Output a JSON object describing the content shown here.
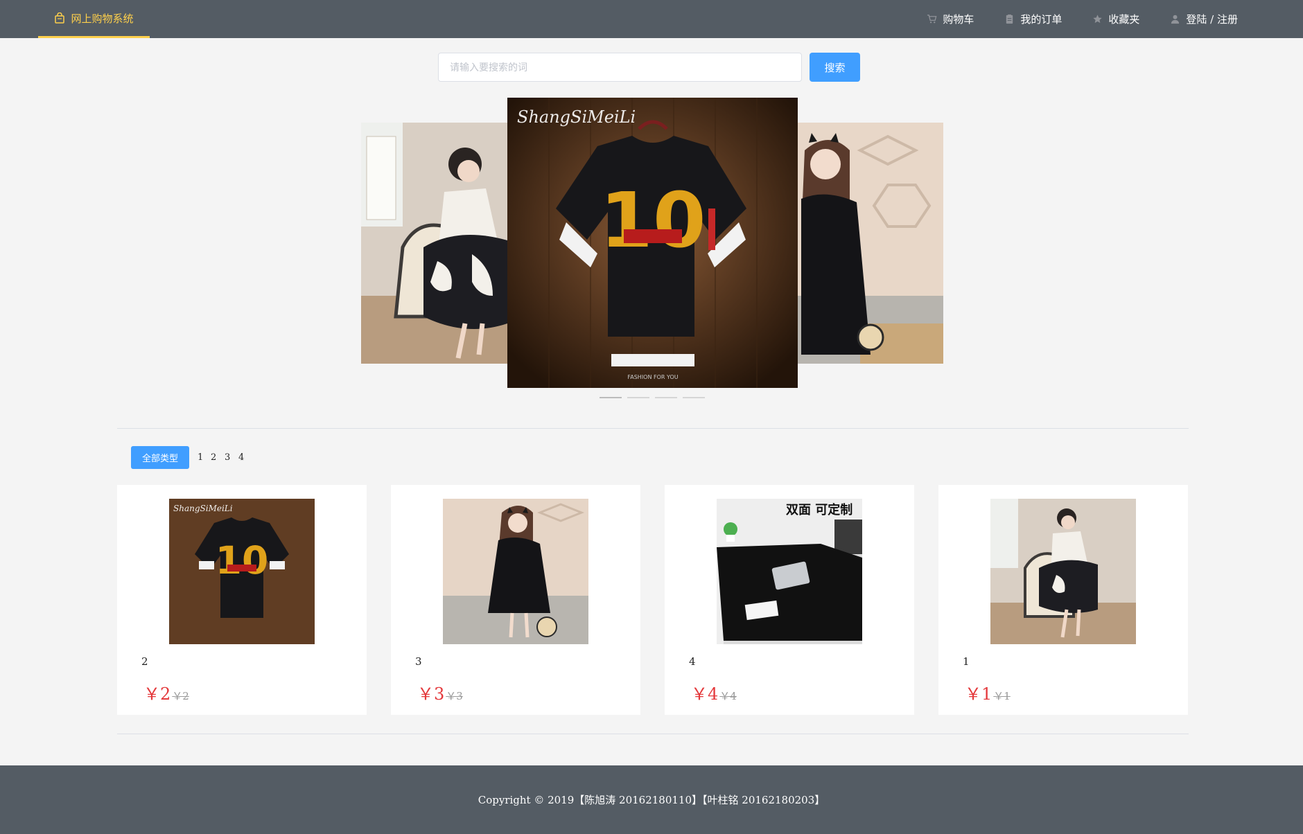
{
  "header": {
    "brand": "网上购物系统",
    "nav": [
      {
        "label": "购物车",
        "icon": "cart-icon"
      },
      {
        "label": "我的订单",
        "icon": "order-icon"
      },
      {
        "label": "收藏夹",
        "icon": "star-icon"
      },
      {
        "label": "登陆 / 注册",
        "icon": "user-icon"
      }
    ],
    "colors": {
      "bar": "#545c64",
      "active": "#ffd04b"
    }
  },
  "search": {
    "placeholder": "请输入要搜索的词",
    "value": "",
    "button": "搜索"
  },
  "carousel": {
    "slides": [
      {
        "name": "woman-in-chair-photo",
        "logo": ""
      },
      {
        "name": "black-tshirt-photo",
        "logo": "ShangSiMeiLi"
      },
      {
        "name": "girl-black-dress-photo",
        "logo": ""
      }
    ],
    "active_index": 0,
    "indicator_count": 4
  },
  "categories": {
    "all_label": "全部类型",
    "items": [
      "1",
      "2",
      "3",
      "4"
    ]
  },
  "products": [
    {
      "name": "2",
      "price": "￥2",
      "old_price": "￥2",
      "image": "black-tshirt-photo"
    },
    {
      "name": "3",
      "price": "￥3",
      "old_price": "￥3",
      "image": "girl-black-dress-photo"
    },
    {
      "name": "4",
      "price": "￥4",
      "old_price": "￥4",
      "image": "desk-mat-photo",
      "image_text": "双面 可定制"
    },
    {
      "name": "1",
      "price": "￥1",
      "old_price": "￥1",
      "image": "woman-in-chair-photo"
    }
  ],
  "footer": {
    "copyright": "Copyright © 2019【陈旭涛 20162180110】【叶柱铭 20162180203】"
  },
  "colors": {
    "primary": "#409eff",
    "price": "#e4393c"
  }
}
